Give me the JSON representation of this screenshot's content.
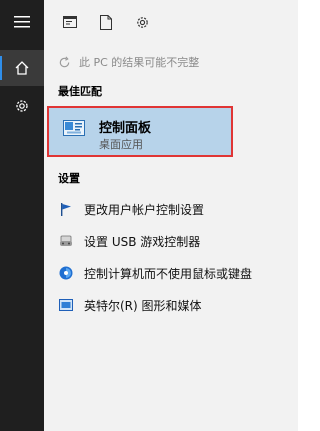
{
  "notice": {
    "text": "此 PC 的结果可能不完整"
  },
  "best_match": {
    "heading": "最佳匹配",
    "title": "控制面板",
    "subtitle": "桌面应用"
  },
  "settings": {
    "heading": "设置",
    "items": [
      {
        "label": "更改用户帐户控制设置",
        "icon": "uac-flag-icon"
      },
      {
        "label": "设置 USB 游戏控制器",
        "icon": "game-controller-icon"
      },
      {
        "label": "控制计算机而不使用鼠标或键盘",
        "icon": "ease-of-access-icon"
      },
      {
        "label": "英特尔(R) 图形和媒体",
        "icon": "intel-graphics-icon"
      }
    ]
  },
  "colors": {
    "rail_bg": "#1f1f1f",
    "panel_bg": "#f2f2f2",
    "selected_bg": "#b7d3ea",
    "highlight_border": "#e03535",
    "accent": "#2f8eea"
  }
}
